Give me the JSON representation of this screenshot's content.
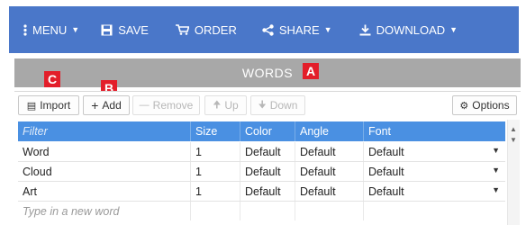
{
  "colors": {
    "menubar": "#4a77c9",
    "panel_header": "#a8a8a8",
    "grid_header": "#4a90e2",
    "badge": "#e31e2a"
  },
  "menubar": {
    "menu": "MENU",
    "save": "SAVE",
    "order": "ORDER",
    "share": "SHARE",
    "download": "DOWNLOAD"
  },
  "panel": {
    "title": "WORDS"
  },
  "badges": {
    "a": "A",
    "b": "B",
    "c": "C"
  },
  "toolbar": {
    "import": "Import",
    "add": "Add",
    "remove": "Remove",
    "up": "Up",
    "down": "Down",
    "options": "Options"
  },
  "grid": {
    "columns": [
      "Filter",
      "Size",
      "Color",
      "Angle",
      "Font"
    ],
    "rows": [
      {
        "word": "Word",
        "size": "1",
        "color": "Default",
        "angle": "Default",
        "font": "Default"
      },
      {
        "word": "Cloud",
        "size": "1",
        "color": "Default",
        "angle": "Default",
        "font": "Default"
      },
      {
        "word": "Art",
        "size": "1",
        "color": "Default",
        "angle": "Default",
        "font": "Default"
      }
    ],
    "new_row_placeholder": "Type in a new word"
  }
}
